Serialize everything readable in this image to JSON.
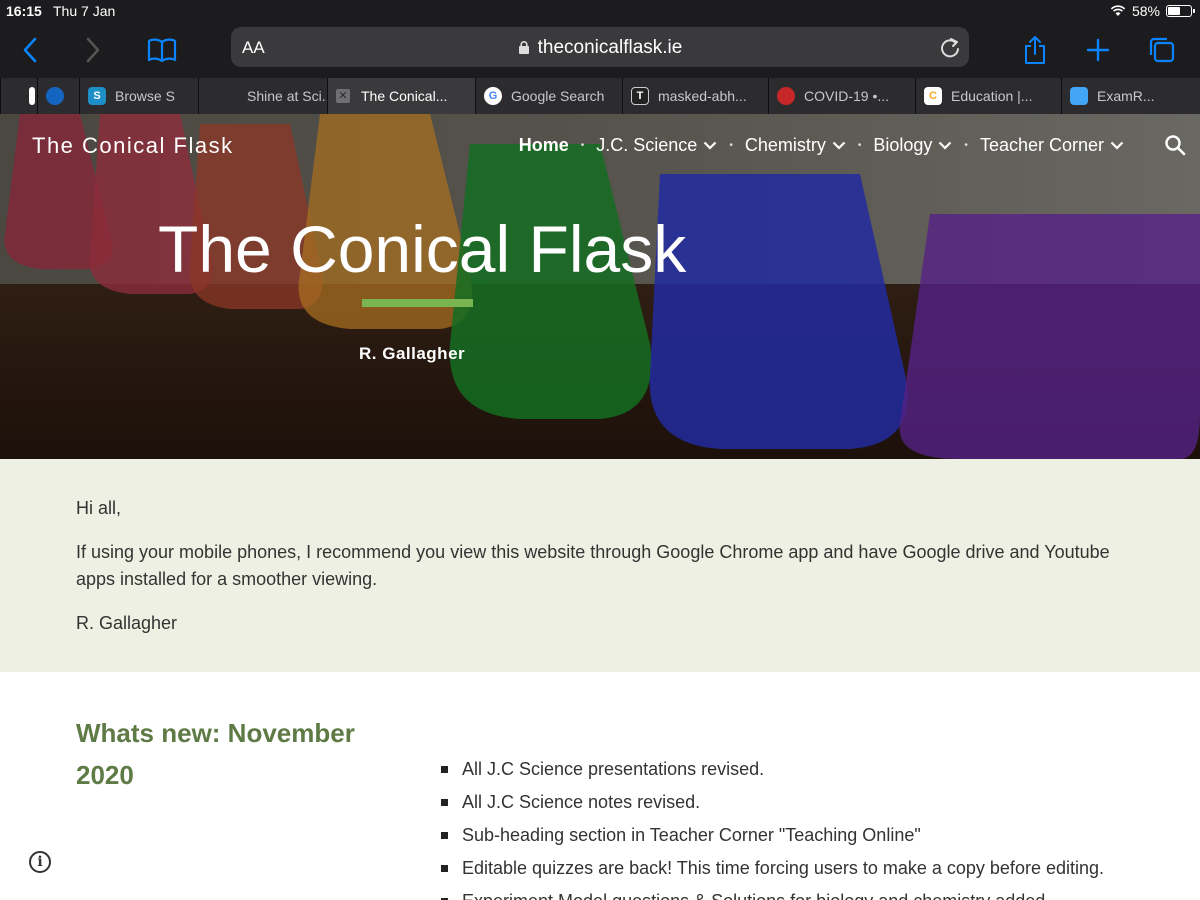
{
  "status": {
    "time": "16:15",
    "date": "Thu 7 Jan",
    "battery": "58%",
    "battery_fraction": 0.58
  },
  "toolbar": {
    "text_size": "AA",
    "url": "theconicalflask.ie"
  },
  "tabs": [
    {
      "label": "",
      "favicon": "globe-icon",
      "color": "#1e88e5"
    },
    {
      "label": "Browse S",
      "favicon": "S",
      "color": "#1e8fc6"
    },
    {
      "label": "Shine at Sci...",
      "favicon": "",
      "color": ""
    },
    {
      "label": "The Conical...",
      "favicon": "close",
      "color": "#6e6e73",
      "active": true
    },
    {
      "label": "Google Search",
      "favicon": "G",
      "color": "#ffffff"
    },
    {
      "label": "masked-abh...",
      "favicon": "T",
      "color": "#222222"
    },
    {
      "label": "COVID-19 •...",
      "favicon": "person-icon",
      "color": "#c62828"
    },
    {
      "label": "Education |...",
      "favicon": "C",
      "color": "#f9a825"
    },
    {
      "label": "ExamR...",
      "favicon": "stack-icon",
      "color": "#42a5f5"
    }
  ],
  "site": {
    "title": "The Conical Flask",
    "nav": [
      {
        "label": "Home",
        "dropdown": false
      },
      {
        "label": "J.C. Science",
        "dropdown": true
      },
      {
        "label": "Chemistry",
        "dropdown": true
      },
      {
        "label": "Biology",
        "dropdown": true
      },
      {
        "label": "Teacher Corner",
        "dropdown": true
      }
    ],
    "hero_title": "The Conical Flask",
    "hero_author": "R. Gallagher",
    "accent_color": "#7ab552"
  },
  "notice": {
    "greeting": "Hi all,",
    "message": "If using your mobile phones, I recommend you view this website through Google Chrome app and have Google drive and Youtube apps installed for a smoother viewing.",
    "signature": "R. Gallagher"
  },
  "whats_new": {
    "title": "Whats new: November 2020",
    "items": [
      "All J.C Science presentations revised.",
      "All J.C Science notes revised.",
      "Sub-heading section in Teacher Corner \"Teaching Online\"",
      "Editable quizzes are back! This time forcing users to make a copy before editing.",
      "Experiment Model questions & Solutions for biology and chemistry added."
    ]
  }
}
